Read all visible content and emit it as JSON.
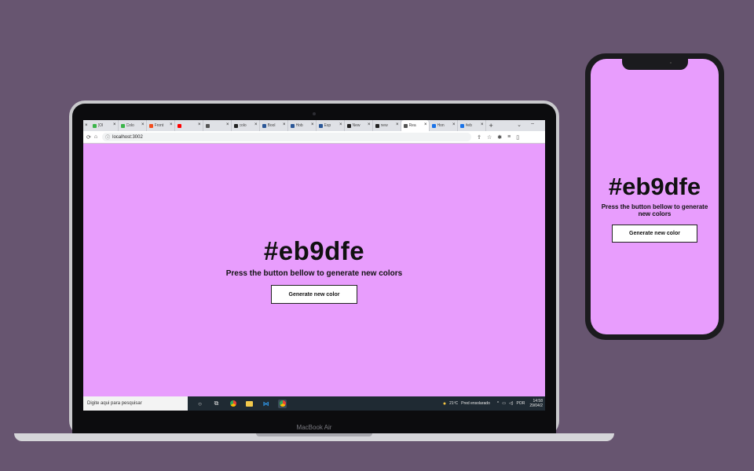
{
  "laptop": {
    "model_label": "MacBook Air",
    "browser": {
      "tabs": [
        {
          "title": "(Ol",
          "favicon": "#3bb54a",
          "active": false
        },
        {
          "title": "Colo",
          "favicon": "#3bb54a",
          "active": false
        },
        {
          "title": "Front",
          "favicon": "#f24e1e",
          "active": false
        },
        {
          "title": "",
          "favicon": "#ff0000",
          "active": false
        },
        {
          "title": "",
          "favicon": "#555555",
          "active": false
        },
        {
          "title": "colo",
          "favicon": "#222222",
          "active": false
        },
        {
          "title": "Bool",
          "favicon": "#2b5797",
          "active": false
        },
        {
          "title": "Hob",
          "favicon": "#2b5797",
          "active": false
        },
        {
          "title": "Esp",
          "favicon": "#2b5797",
          "active": false
        },
        {
          "title": "New",
          "favicon": "#222222",
          "active": false
        },
        {
          "title": "new",
          "favicon": "#222222",
          "active": false
        },
        {
          "title": "Rea",
          "favicon": "#555555",
          "active": true
        },
        {
          "title": "Hon",
          "favicon": "#1a73e8",
          "active": false
        },
        {
          "title": "#eb",
          "favicon": "#1a73e8",
          "active": false
        }
      ],
      "new_tab": "+",
      "url": "localhost:3002"
    },
    "app": {
      "color_hex": "#eb9dfe",
      "instruction": "Press the button bellow to generate new colors",
      "button_label": "Generate new color",
      "background": "#e89dfd"
    },
    "taskbar": {
      "search_placeholder": "Digite aqui para pesquisar",
      "weather": "21ºC",
      "weather_desc": "Pred ensolarado",
      "lang": "POR",
      "time": "14:58",
      "date": "29/04/2"
    }
  },
  "phone": {
    "app": {
      "color_hex": "#eb9dfe",
      "instruction": "Press the button bellow to generate new colors",
      "button_label": "Generate new color",
      "background": "#e89dfd"
    }
  },
  "colors": {
    "backdrop": "#675570",
    "app_background": "#e89dfd"
  }
}
